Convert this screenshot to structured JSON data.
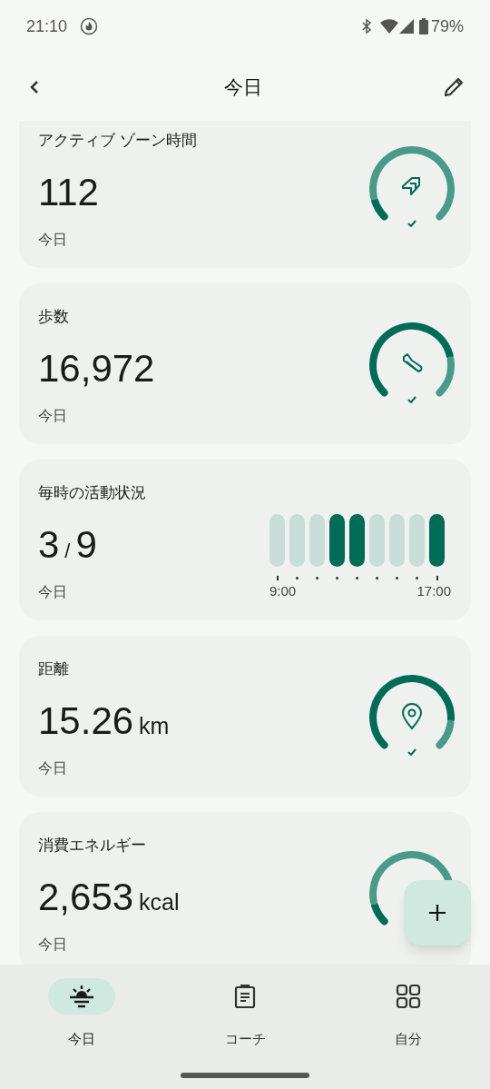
{
  "status_bar": {
    "time": "21:10",
    "battery": "79%"
  },
  "header": {
    "title": "今日"
  },
  "cards": [
    {
      "kind": "ring",
      "title": "アクティブ ゾーン時間",
      "value": "112",
      "caption": "今日"
    },
    {
      "kind": "ring",
      "title": "歩数",
      "value": "16,972",
      "caption": "今日"
    },
    {
      "kind": "hourly",
      "title": "毎時の活動状況",
      "value": "3",
      "separator": "/",
      "total": "9",
      "caption": "今日",
      "hours": [
        {
          "active": false
        },
        {
          "active": false
        },
        {
          "active": false
        },
        {
          "active": true
        },
        {
          "active": true
        },
        {
          "active": false
        },
        {
          "active": false
        },
        {
          "active": false
        },
        {
          "active": true
        }
      ],
      "start_label": "9:00",
      "end_label": "17:00"
    },
    {
      "kind": "ring",
      "title": "距離",
      "value": "15.26",
      "unit": "km",
      "caption": "今日"
    },
    {
      "kind": "ring",
      "title": "消費エネルギー",
      "value": "2,653",
      "unit": "kcal",
      "caption": "今日"
    }
  ],
  "nav": [
    {
      "label": "今日",
      "selected": true
    },
    {
      "label": "コーチ",
      "selected": false
    },
    {
      "label": "自分",
      "selected": false
    }
  ]
}
